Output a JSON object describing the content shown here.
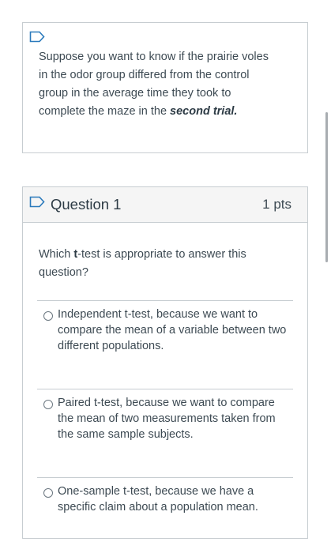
{
  "intro": {
    "text_before": "Suppose you want to know if the prairie voles in the odor group differed from the control group in the average time they took to complete the maze in the ",
    "text_emphasis": "second trial."
  },
  "question": {
    "title": "Question 1",
    "points": "1 pts",
    "prompt_before": "Which ",
    "prompt_bold": "t",
    "prompt_after": "-test is appropriate to answer this question?",
    "options": [
      "Independent t-test, because we want to compare the mean of a variable between two different populations.",
      "Paired t-test, because we want to compare the mean of two measurements taken from the same sample subjects.",
      "One-sample t-test, because we have a specific claim about a population mean."
    ]
  },
  "icons": {
    "flag": "flag-icon",
    "radio": "radio-button"
  },
  "colors": {
    "accent": "#2b7abc",
    "text": "#2d3b45",
    "border": "#c7cdd1",
    "header_bg": "#f5f5f5"
  }
}
